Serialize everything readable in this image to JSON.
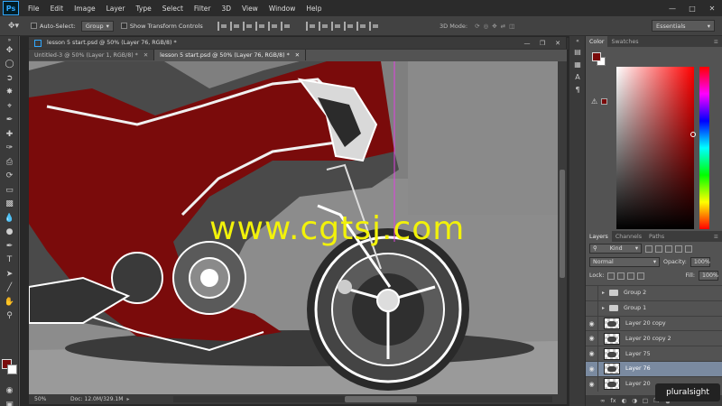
{
  "app": {
    "logo": "Ps",
    "menu": [
      "File",
      "Edit",
      "Image",
      "Layer",
      "Type",
      "Select",
      "Filter",
      "3D",
      "View",
      "Window",
      "Help"
    ]
  },
  "options_bar": {
    "auto_select_label": "Auto-Select:",
    "auto_select_value": "Group",
    "show_transform_label": "Show Transform Controls",
    "mode_3d_label": "3D Mode:",
    "workspace": "Essentials"
  },
  "document": {
    "tabs": [
      {
        "label": "Untitled-3 @ 50% (Layer 1, RGB/8) *",
        "active": false
      },
      {
        "label": "lesson 5 start.psd @ 50% (Layer 76, RGB/8) *",
        "active": true
      }
    ],
    "window_title": "lesson 5 start.psd @ 50% (Layer 76, RGB/8) *",
    "zoom": "50%",
    "doc_size": "Doc: 12.0M/329.1M",
    "watermark": "www.cgtsj.com"
  },
  "color_panel": {
    "tabs": [
      "Color",
      "Swatches"
    ],
    "foreground": "#7a0b0b",
    "background": "#ffffff"
  },
  "layers_panel": {
    "tabs": [
      "Layers",
      "Channels",
      "Paths"
    ],
    "filter": "Kind",
    "blend_mode": "Normal",
    "opacity_label": "Opacity:",
    "opacity": "100%",
    "lock_label": "Lock:",
    "fill_label": "Fill:",
    "fill": "100%",
    "layers": [
      {
        "name": "Group 2",
        "type": "group",
        "visible": false,
        "selected": false
      },
      {
        "name": "Group 1",
        "type": "group",
        "visible": false,
        "selected": false
      },
      {
        "name": "Layer 20 copy",
        "type": "layer",
        "visible": true,
        "selected": false
      },
      {
        "name": "Layer 20 copy 2",
        "type": "layer",
        "visible": true,
        "selected": false
      },
      {
        "name": "Layer 75",
        "type": "layer",
        "visible": true,
        "selected": false
      },
      {
        "name": "Layer 76",
        "type": "layer",
        "visible": true,
        "selected": true
      },
      {
        "name": "Layer 20",
        "type": "layer",
        "visible": true,
        "selected": false
      }
    ]
  },
  "branding": "pluralsight",
  "colors": {
    "accent_red": "#7a0b0b",
    "watermark_yellow": "#f2f20a",
    "selection": "#7a8aa0"
  }
}
